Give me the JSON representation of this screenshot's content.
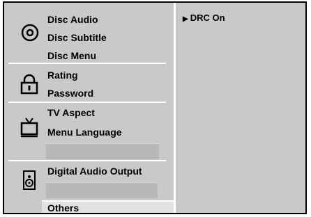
{
  "menu": {
    "disc_group": {
      "icon": "disc-icon",
      "items": [
        "Disc Audio",
        "Disc Subtitle",
        "Disc Menu"
      ]
    },
    "lock_group": {
      "icon": "lock-icon",
      "items": [
        "Rating",
        "Password"
      ]
    },
    "tv_group": {
      "icon": "tv-icon",
      "items": [
        "TV Aspect",
        "Menu Language"
      ]
    },
    "speaker_group": {
      "icon": "speaker-icon",
      "items": [
        "Digital Audio Output"
      ]
    },
    "others": {
      "label": "Others",
      "selected": true
    }
  },
  "panel": {
    "marker": "▶",
    "option": "DRC On"
  },
  "colors": {
    "background": "#c9c9c9",
    "highlight": "#e2e2e2",
    "divider": "#ffffff",
    "blank_slot": "#b8b8b8"
  }
}
